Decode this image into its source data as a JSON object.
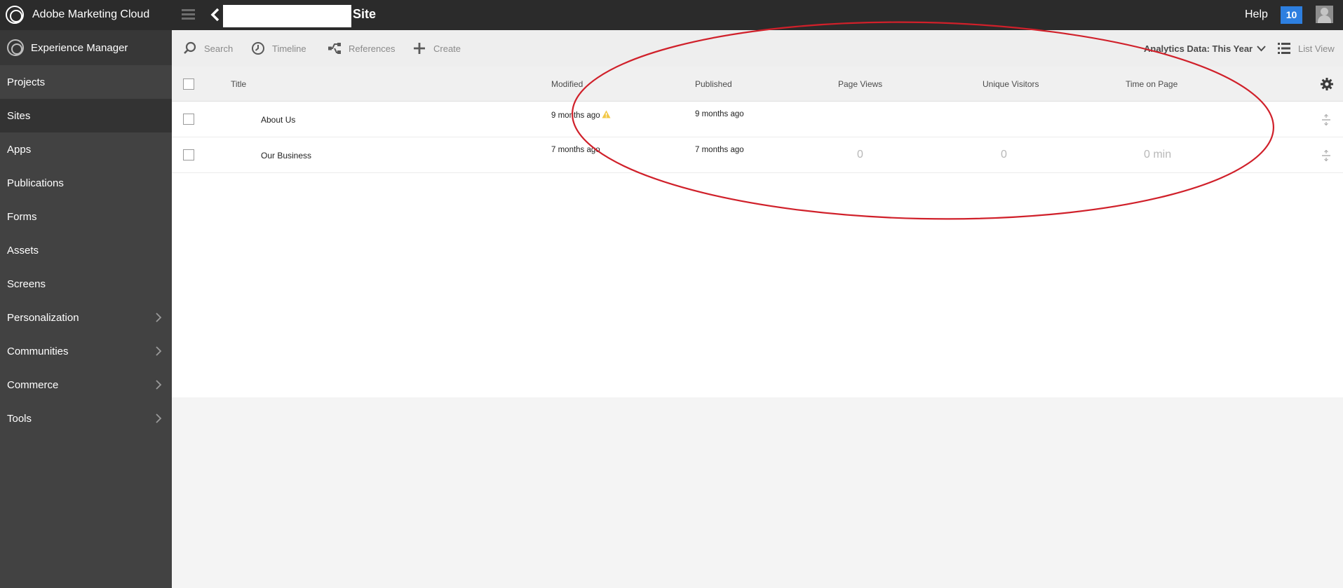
{
  "topbar": {
    "brand": "Adobe Marketing Cloud",
    "site_title": "Site",
    "help": "Help",
    "notifications": "10"
  },
  "sidebar": {
    "header": "Experience Manager",
    "items": [
      {
        "label": "Projects"
      },
      {
        "label": "Sites",
        "active": true
      },
      {
        "label": "Apps"
      },
      {
        "label": "Publications"
      },
      {
        "label": "Forms"
      },
      {
        "label": "Assets"
      },
      {
        "label": "Screens"
      },
      {
        "label": "Personalization",
        "has_children": true
      },
      {
        "label": "Communities",
        "has_children": true
      },
      {
        "label": "Commerce",
        "has_children": true
      },
      {
        "label": "Tools",
        "has_children": true
      }
    ]
  },
  "toolbar": {
    "search": "Search",
    "timeline": "Timeline",
    "references": "References",
    "create": "Create",
    "analytics": "Analytics Data: This Year",
    "list_view": "List View"
  },
  "table": {
    "columns": {
      "title": "Title",
      "modified": "Modified",
      "published": "Published",
      "page_views": "Page Views",
      "unique_visitors": "Unique Visitors",
      "time_on_page": "Time on Page"
    },
    "rows": [
      {
        "title": "About Us",
        "modified": "9 months ago",
        "modified_warning": true,
        "published": "9 months ago",
        "page_views": "",
        "unique_visitors": "",
        "time_on_page": ""
      },
      {
        "title": "Our Business",
        "modified": "7 months ago",
        "modified_warning": false,
        "published": "7 months ago",
        "page_views": "0",
        "unique_visitors": "0",
        "time_on_page": "0 min"
      }
    ]
  },
  "colors": {
    "topbar_bg": "#2b2b2b",
    "sidebar_bg": "#424242",
    "notification_badge": "#2d7fe0",
    "annotation_ellipse": "#d0202a",
    "warning_icon": "#f2c744"
  }
}
